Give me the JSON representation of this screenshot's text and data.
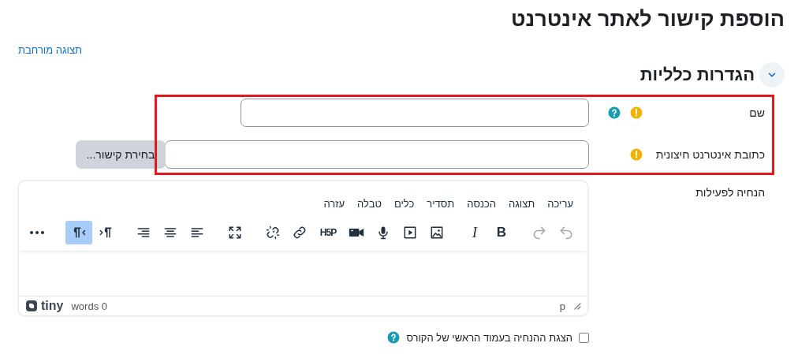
{
  "page": {
    "title": "הוספת קישור לאתר אינטרנט",
    "expand_link": "תצוגה מורחבת"
  },
  "section": {
    "title": "הגדרות כלליות",
    "expanded": true
  },
  "fields": [
    {
      "kind": "text",
      "label": "שם",
      "required": true,
      "help": true
    },
    {
      "kind": "url",
      "label": "כתובת אינטרנט חיצונית",
      "required": true,
      "help": false,
      "button": "בחירת קישור..."
    }
  ],
  "editor": {
    "label": "הנחיה לפעילות",
    "menu": [
      "עריכה",
      "תצוגה",
      "הכנסה",
      "תסדיר",
      "כלים",
      "טבלה",
      "עזרה"
    ],
    "toolbar": [
      {
        "items": [
          {
            "kind": "undo",
            "disabled": true
          },
          {
            "kind": "redo",
            "disabled": true
          }
        ]
      },
      {
        "items": [
          {
            "kind": "bold",
            "label": "B"
          },
          {
            "kind": "italic",
            "label": "I"
          }
        ]
      },
      {
        "items": [
          {
            "kind": "image"
          },
          {
            "kind": "media"
          },
          {
            "kind": "microphone"
          },
          {
            "kind": "video-camera"
          },
          {
            "kind": "h5p",
            "label": "H5P"
          },
          {
            "kind": "link"
          },
          {
            "kind": "unlink"
          }
        ]
      },
      {
        "items": [
          {
            "kind": "fullscreen"
          }
        ]
      },
      {
        "items": [
          {
            "kind": "align-left"
          },
          {
            "kind": "align-center"
          },
          {
            "kind": "align-right"
          }
        ]
      },
      {
        "items": [
          {
            "kind": "ltr",
            "pressed": false
          },
          {
            "kind": "rtl",
            "pressed": true
          }
        ]
      },
      {
        "items": [
          {
            "kind": "more"
          }
        ]
      }
    ],
    "status": {
      "brand": "tiny",
      "word_count": "words 0",
      "path": "p"
    }
  },
  "checkbox": {
    "label": "הצגת ההנחיה בעמוד הראשי של הקורס",
    "checked": false,
    "help": true
  }
}
